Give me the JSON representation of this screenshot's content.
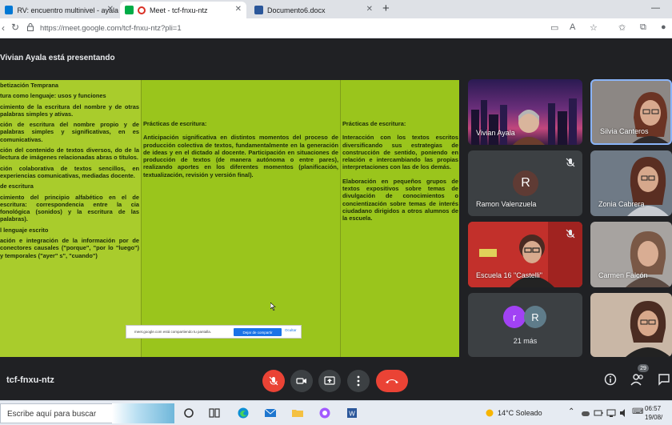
{
  "browser": {
    "tabs": [
      {
        "label": "RV: encuentro multinivel - ayala",
        "color": "#0078d4"
      },
      {
        "label": "Meet - tcf-fnxu-ntz",
        "color": "#00ac47"
      },
      {
        "label": "Documento6.docx",
        "color": "#2b579a"
      }
    ],
    "url": "https://meet.google.com/tcf-fnxu-ntz?pli=1"
  },
  "meet": {
    "presenter_label": "Vivian Ayala está presentando",
    "meeting_code": "tcf-fnxu-ntz",
    "people_count": "29",
    "more_count": "21 más",
    "participants": [
      {
        "name": "Vivian Ayala",
        "muted": false
      },
      {
        "name": "Silvia Canteros",
        "muted": false
      },
      {
        "name": "Ramon Valenzuela",
        "muted": true,
        "initial": "R"
      },
      {
        "name": "Zonia Cabrera",
        "muted": false
      },
      {
        "name": "Escuela 16 \"Castelli\"",
        "muted": true
      },
      {
        "name": "Carmen Falcón",
        "muted": false
      }
    ],
    "more_avatars": [
      "r",
      "R"
    ]
  },
  "document": {
    "col1": [
      "betización Temprana",
      "tura como lenguaje: usos y funciones",
      "cimiento de la escritura del nombre y de otras palabras simples y ativas.",
      "ción de escritura del nombre propio y de palabras simples y significativas, en es comunicativas.",
      "ción del contenido de textos diversos, do de la lectura de imágenes relacionadas abras o títulos.",
      "ción colaborativa de textos sencillos, en experiencias comunicativas, mediadas docente.",
      "de escritura",
      "cimiento del principio alfabético en el de escritura: correspondencia entre la cia fonológica (sonidos) y la escritura de las palabras).",
      "l lenguaje escrito",
      "ación e integración de la información por de conectores causales (\"porque\", \"por lo \"luego\") y temporales (\"ayer\" s\", \"cuando\")"
    ],
    "col2": [
      "Prácticas de escritura:",
      "Anticipación significativa en distintos momentos del proceso de producción colectiva de textos, fundamentalmente en la generación de ideas y en el dictado al docente. Participación en situaciones de producción de textos (de manera autónoma o entre pares), realizando aportes en los diferentes momentos (planificación, textualización, revisión y versión final)."
    ],
    "col3": [
      "Prácticas de escritura:",
      "Interacción con los textos escritos diversificando sus estrategias de construcción de sentido, poniendo en relación e intercambiando las propias interpretaciones con las de los demás.",
      "Elaboración en pequeños grupos de textos expositivos sobre temas de divulgación de conocimientos o concientización sobre temas de interés ciudadano dirigidos a otros alumnos de la escuela."
    ]
  },
  "share_notice": {
    "text": "meet.google.com está compartiendo tu pantalla.",
    "stop_label": "Dejar de compartir",
    "hide_label": "Ocultar"
  },
  "taskbar": {
    "search_placeholder": "Escribe aquí para buscar",
    "weather": "14°C  Soleado",
    "time": "06:57",
    "date": "19/08/"
  }
}
